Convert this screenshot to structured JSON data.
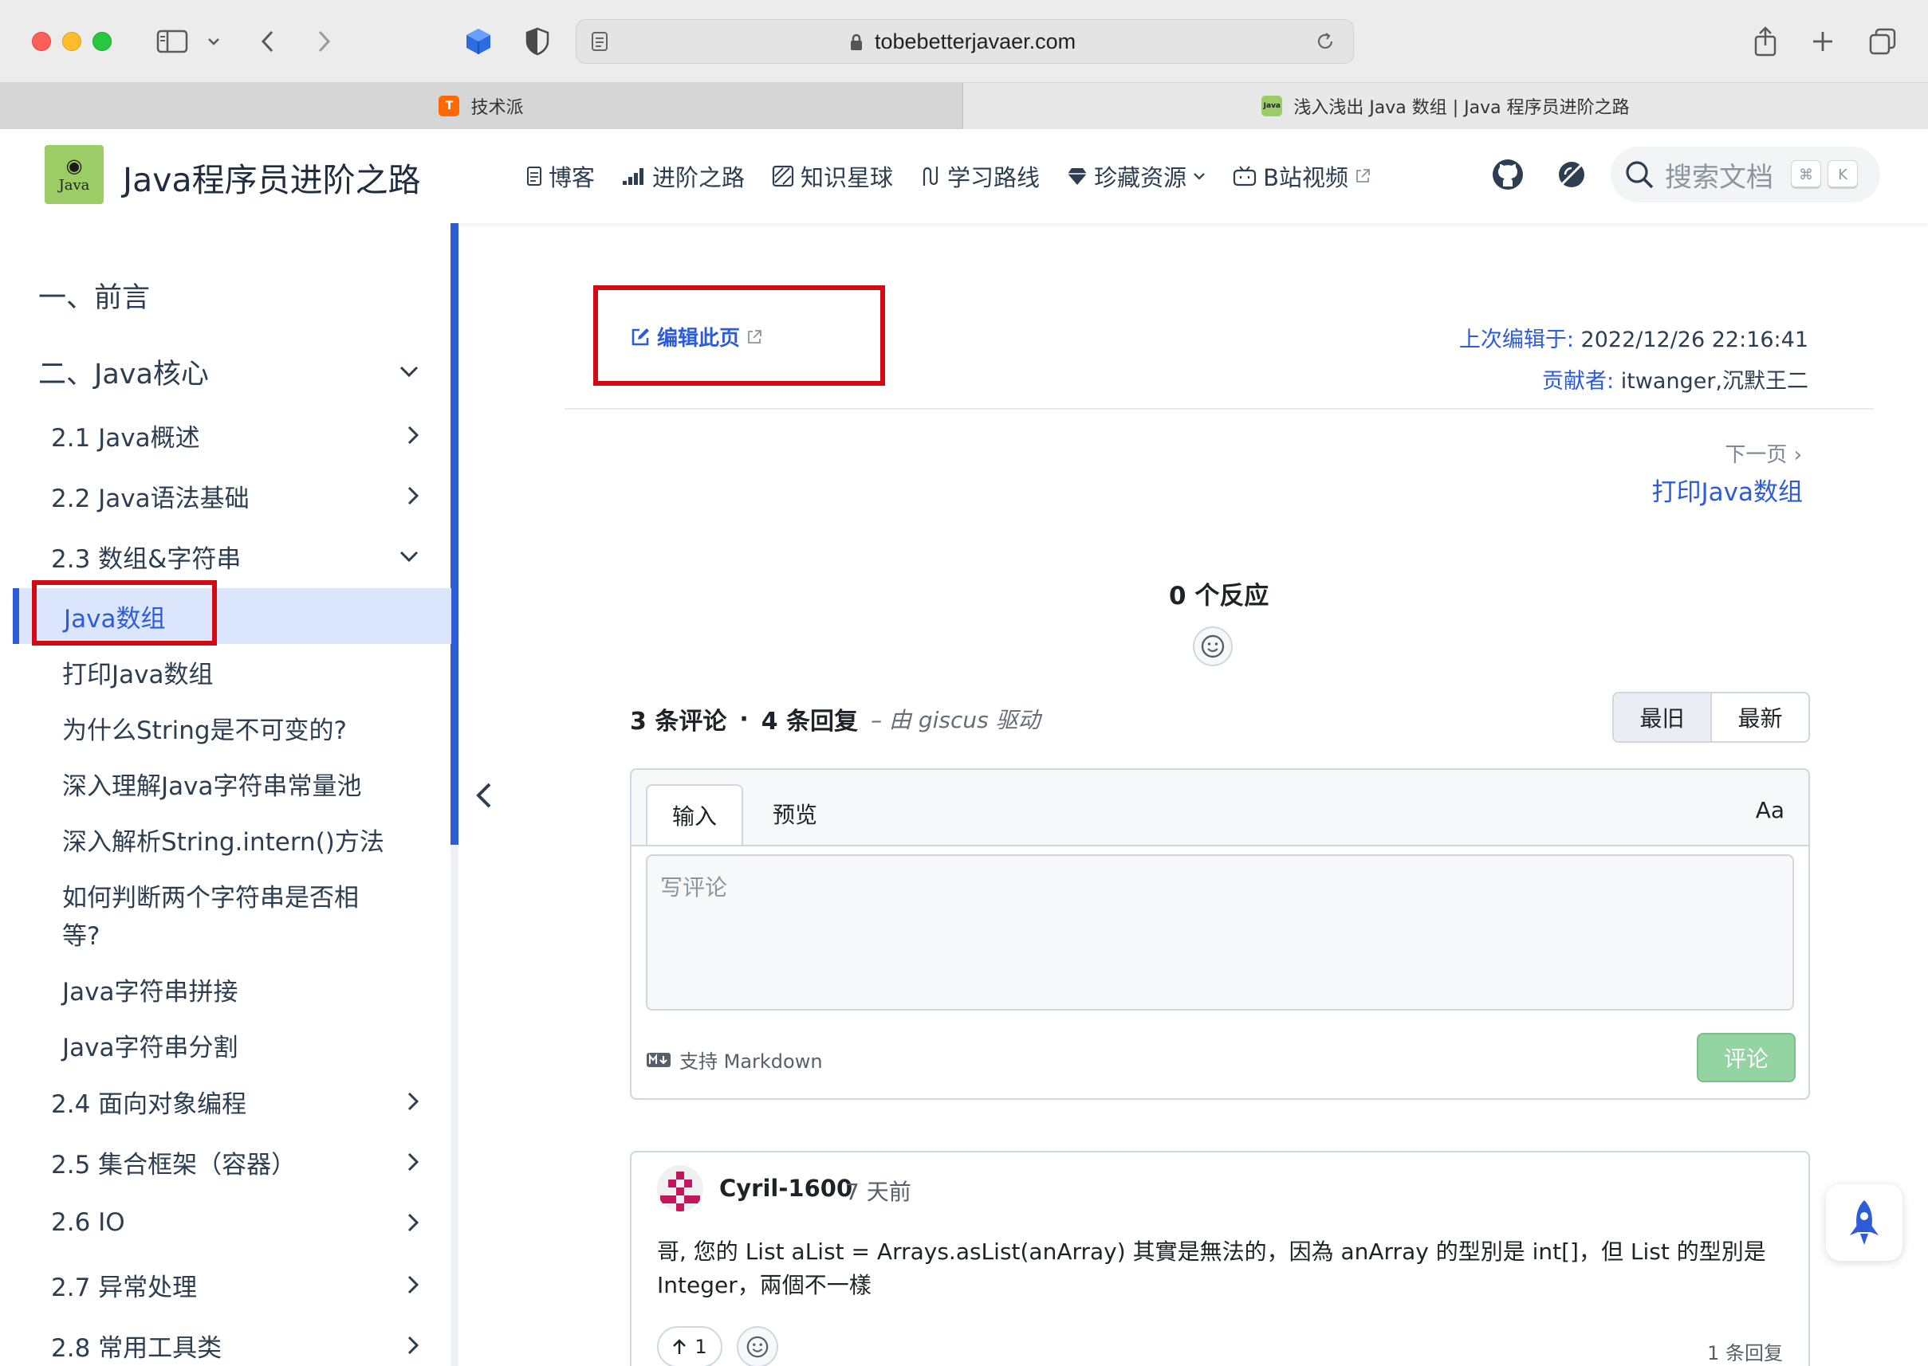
{
  "browser": {
    "url": "tobebetterjavaer.com",
    "tabs": [
      {
        "title": "技术派",
        "active": false
      },
      {
        "title": "浅入浅出 Java 数组 | Java 程序员进阶之路",
        "active": true
      }
    ]
  },
  "site": {
    "logo_text": "Java",
    "title": "Java程序员进阶之路",
    "nav": [
      {
        "label": "博客",
        "icon": "document-icon"
      },
      {
        "label": "进阶之路",
        "icon": "signal-icon"
      },
      {
        "label": "知识星球",
        "icon": "planet-icon"
      },
      {
        "label": "学习路线",
        "icon": "route-icon"
      },
      {
        "label": "珍藏资源",
        "icon": "diamond-icon"
      },
      {
        "label": "B站视频",
        "icon": "tv-icon"
      }
    ],
    "search": {
      "placeholder": "搜索文档",
      "kbd1": "⌘",
      "kbd2": "K"
    }
  },
  "sidebar": {
    "items": [
      {
        "label": "一、前言"
      },
      {
        "label": "二、Java核心",
        "chevron": "down"
      },
      {
        "label": "2.1 Java概述",
        "chevron": "right"
      },
      {
        "label": "2.2 Java语法基础",
        "chevron": "right"
      },
      {
        "label": "2.3 数组&字符串",
        "chevron": "down"
      },
      {
        "label": "Java数组",
        "active": true
      },
      {
        "label": "打印Java数组"
      },
      {
        "label": "为什么String是不可变的?"
      },
      {
        "label": "深入理解Java字符串常量池"
      },
      {
        "label": "深入解析String.intern()方法"
      },
      {
        "label": "如何判断两个字符串是否相"
      },
      {
        "label": "等?"
      },
      {
        "label": "Java字符串拼接"
      },
      {
        "label": "Java字符串分割"
      },
      {
        "label": "2.4 面向对象编程",
        "chevron": "right"
      },
      {
        "label": "2.5 集合框架（容器）",
        "chevron": "right"
      },
      {
        "label": "2.6 IO",
        "chevron": "right"
      },
      {
        "label": "2.7 异常处理",
        "chevron": "right"
      },
      {
        "label": "2.8 常用工具类",
        "chevron": "right"
      }
    ]
  },
  "page": {
    "edit_label": "编辑此页",
    "last_edit_key": "上次编辑于:",
    "last_edit_value": " 2022/12/26 22:16:41",
    "contributors_key": "贡献者:",
    "contributors_value": " itwanger,沉默王二",
    "next_label": "下一页 ›",
    "next_title": "打印Java数组"
  },
  "giscus": {
    "reactions_title": "0 个反应",
    "comment_count": "3 条评论",
    "dot": "·",
    "reply_count": "4 条回复",
    "powered_by": "– 由 giscus 驱动",
    "sort_oldest": "最旧",
    "sort_newest": "最新",
    "tab_write": "输入",
    "tab_preview": "预览",
    "aa": "Aa",
    "placeholder": "写评论",
    "markdown": "支持 Markdown",
    "submit": "评论",
    "comment": {
      "user": "Cyril-1600",
      "time": "7 天前",
      "body_line1": "哥, 您的 List aList = Arrays.asList(anArray) 其實是無法的，因為 anArray 的型別是 int[]，但 List 的型別是",
      "body_line2": "Integer，兩個不一樣",
      "upvotes": "1",
      "replies": "1 条回复"
    }
  },
  "colors": {
    "accent": "#2e5cd6",
    "highlight_box": "#d20a13",
    "active_bg": "#dbe6fd"
  }
}
